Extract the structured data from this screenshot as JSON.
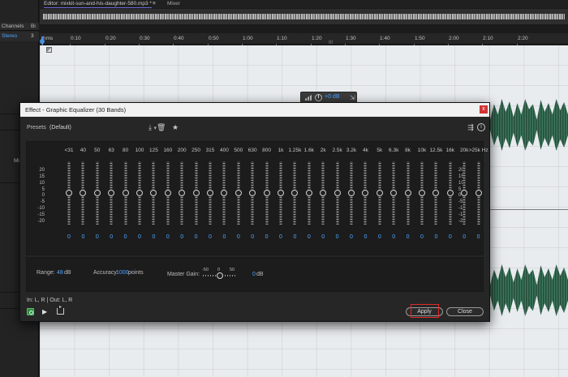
{
  "editor": {
    "tab_label": "Editor: mixkit-sun-and-his-daughter-580.mp3 *",
    "menu_icon": "≡",
    "mixer_label": "Mixer"
  },
  "left_panel": {
    "header_channels": "Channels",
    "header_bit": "Bi",
    "row_value": "Stereo",
    "row_value2": "3",
    "mu": "Mi"
  },
  "ruler": {
    "ticks": [
      "hms",
      "0:10",
      "0:20",
      "0:30",
      "0:40",
      "0:50",
      "1:00",
      "1:10",
      "1:20",
      "1:30",
      "1:40",
      "1:50",
      "2:00",
      "2:10",
      "2:20"
    ],
    "zoom_handle": "III"
  },
  "hud": {
    "value": "+0 dB",
    "icon_names": [
      "level-bars-icon",
      "volume-knob-icon",
      "pin-icon"
    ]
  },
  "dialog": {
    "title": "Effect - Graphic Equalizer (30 Bands)",
    "close_glyph": "x",
    "presets_label": "Presets:",
    "presets_value": "(Default)",
    "bands": [
      "<31",
      "40",
      "50",
      "63",
      "80",
      "100",
      "125",
      "160",
      "200",
      "250",
      "315",
      "400",
      "500",
      "630",
      "800",
      "1k",
      "1.25k",
      "1.6k",
      "2k",
      "2.5k",
      "3.2k",
      "4k",
      "5k",
      "6.3k",
      "8k",
      "10k",
      "12.5k",
      "16k",
      "20k",
      ">25k Hz"
    ],
    "gains": [
      "0",
      "0",
      "0",
      "0",
      "0",
      "0",
      "0",
      "0",
      "0",
      "0",
      "0",
      "0",
      "0",
      "0",
      "0",
      "0",
      "0",
      "0",
      "0",
      "0",
      "0",
      "0",
      "0",
      "0",
      "0",
      "0",
      "0",
      "0",
      "0",
      "0"
    ],
    "scale": [
      "20",
      "15",
      "10",
      "5",
      "0",
      "-5",
      "-10",
      "-15",
      "-20"
    ],
    "range_label": "Range:",
    "range_value": "48",
    "range_unit": "dB",
    "accuracy_label": "Accuracy:",
    "accuracy_value": "1000",
    "accuracy_unit": "points",
    "master_gain_label": "Master Gain:",
    "master_gain_min": "-50",
    "master_gain_mid": "0",
    "master_gain_max": "50",
    "master_gain_value": "0",
    "master_gain_unit": "dB",
    "io_text": "In: L, R | Out: L, R",
    "apply_label": "Apply",
    "close_label": "Close",
    "accent_color": "#4ea6ff",
    "highlight_color": "#e12b2b"
  }
}
